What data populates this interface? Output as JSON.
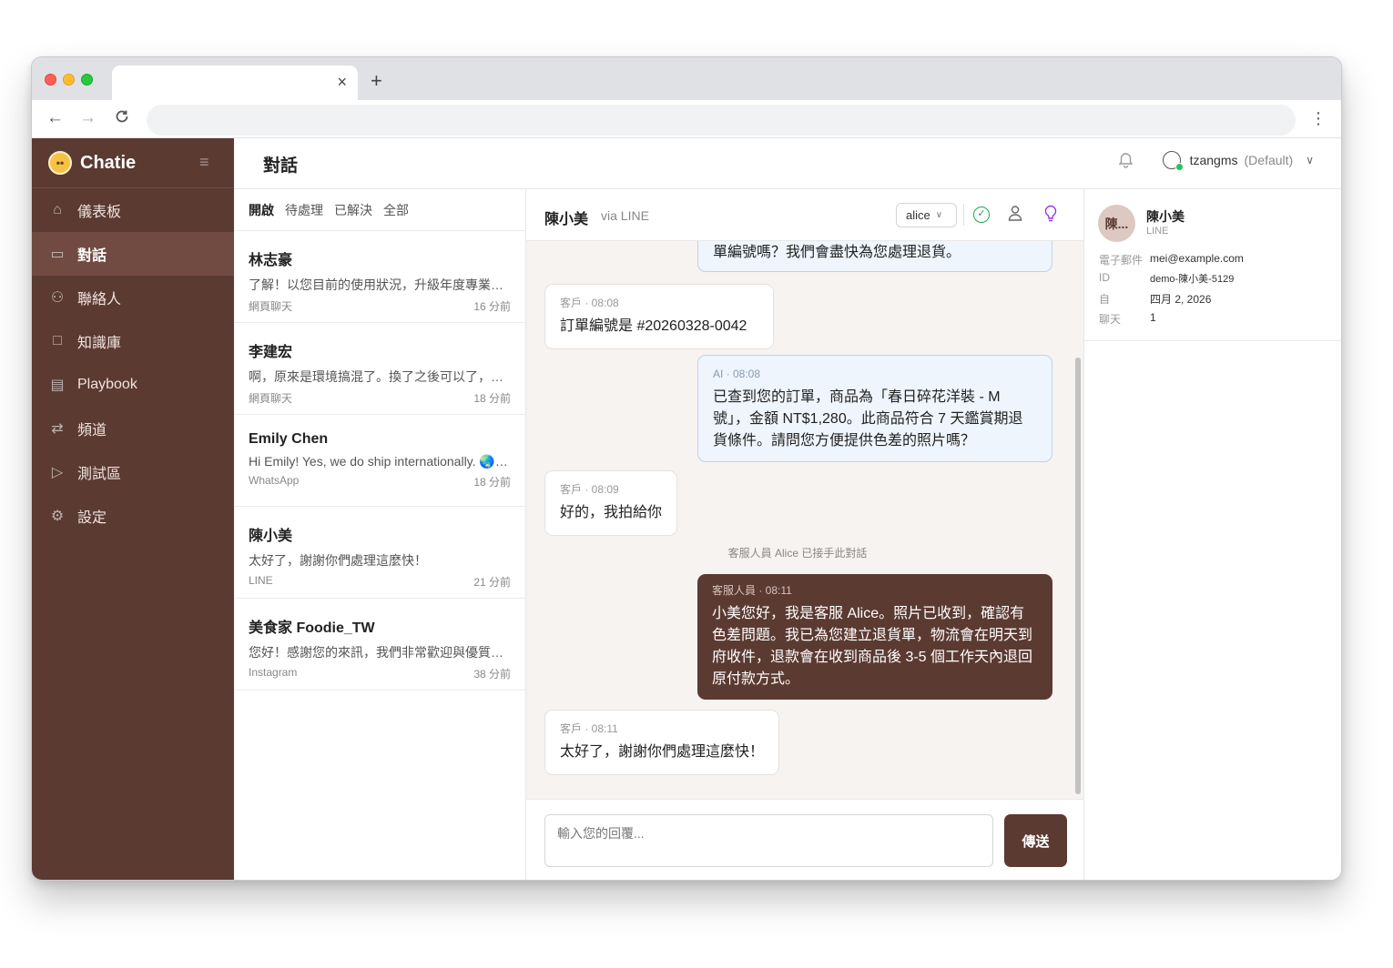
{
  "browser": {
    "tab_close": "×",
    "new_tab": "+",
    "back": "←",
    "forward": "→",
    "reload": "C",
    "menu": "⋮"
  },
  "brand": {
    "name": "Chatie"
  },
  "nav": {
    "items": [
      {
        "label": "儀表板",
        "icon": "home-icon",
        "glyph": "⌂"
      },
      {
        "label": "對話",
        "icon": "chat-icon",
        "glyph": "▭"
      },
      {
        "label": "聯絡人",
        "icon": "users-icon",
        "glyph": "⚇"
      },
      {
        "label": "知識庫",
        "icon": "book-icon",
        "glyph": "□"
      },
      {
        "label": "Playbook",
        "icon": "clipboard-icon",
        "glyph": "▤"
      },
      {
        "label": "頻道",
        "icon": "arrows-icon",
        "glyph": "⇄"
      },
      {
        "label": "測試區",
        "icon": "play-icon",
        "glyph": "▷"
      },
      {
        "label": "設定",
        "icon": "gear-icon",
        "glyph": "⚙"
      }
    ],
    "active_index": 1
  },
  "header": {
    "title": "對話",
    "user": {
      "name": "tzangms",
      "workspace": "(Default)"
    }
  },
  "filters": [
    "開啟",
    "待處理",
    "已解決",
    "全部"
  ],
  "conversations": [
    {
      "name": "林志豪",
      "preview": "了解！以您目前的使用狀況，升級年度專業方案會更划算",
      "channel": "網頁聊天",
      "time": "16 分前"
    },
    {
      "name": "李建宏",
      "preview": "啊，原來是環境搞混了。換了之後可以了，謝謝",
      "channel": "網頁聊天",
      "time": "18 分前"
    },
    {
      "name": "Emily Chen",
      "preview": "Hi Emily! Yes, we do ship internationally. 🌏 We ship",
      "channel": "WhatsApp",
      "time": "18 分前"
    },
    {
      "name": "陳小美",
      "preview": "太好了，謝謝你們處理這麼快！",
      "channel": "LINE",
      "time": "21 分前"
    },
    {
      "name": "美食家 Foodie_TW",
      "preview": "您好！感謝您的來訊，我們非常歡迎與優質的創作者合作",
      "channel": "Instagram",
      "time": "38 分前"
    }
  ],
  "chat": {
    "name": "陳小美",
    "via": "via LINE",
    "assignee": "alice",
    "messages": [
      {
        "kind": "ai_partial",
        "text": "單編號嗎？我們會盡快為您處理退貨。"
      },
      {
        "kind": "customer",
        "meta": "客戶 · 08:08",
        "text": "訂單編號是 #20260328-0042"
      },
      {
        "kind": "ai",
        "meta": "AI · 08:08",
        "text": "已查到您的訂單，商品為「春日碎花洋裝 - M 號」，金額 NT$1,280。此商品符合 7 天鑑賞期退貨條件。請問您方便提供色差的照片嗎？"
      },
      {
        "kind": "customer",
        "meta": "客戶 · 08:09",
        "text": "好的，我拍給你"
      },
      {
        "kind": "system",
        "text": "客服人員 Alice 已接手此對話"
      },
      {
        "kind": "agent",
        "meta": "客服人員 · 08:11",
        "text": "小美您好，我是客服 Alice。照片已收到，確認有色差問題。我已為您建立退貨單，物流會在明天到府收件，退款會在收到商品後 3-5 個工作天內退回原付款方式。"
      },
      {
        "kind": "customer",
        "meta": "客戶 · 08:11",
        "text": "太好了，謝謝你們處理這麼快！"
      }
    ],
    "reply_placeholder": "輸入您的回覆...",
    "send_label": "傳送"
  },
  "contact": {
    "avatar_text": "陳...",
    "name": "陳小美",
    "channel": "LINE",
    "fields": [
      {
        "label": "電子郵件",
        "value": "mei@example.com"
      },
      {
        "label": "ID",
        "value": "demo-陳小美-5129"
      },
      {
        "label": "自",
        "value": "四月 2, 2026"
      },
      {
        "label": "聊天",
        "value": "1"
      }
    ]
  },
  "colors": {
    "brand": "#5b3a32",
    "brand_active": "#714b42",
    "ai_bubble": "#eef5fd",
    "ai_border": "#b9d4f1",
    "resolve_green": "#22a55a",
    "ai_purple": "#9333ea"
  }
}
